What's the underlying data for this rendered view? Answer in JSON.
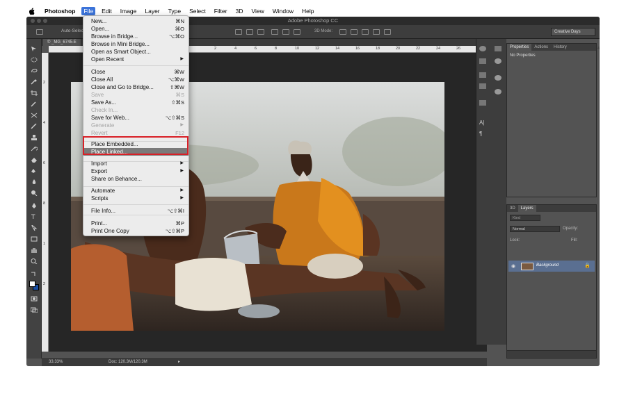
{
  "macbar": {
    "app": "Photoshop",
    "menus": [
      "File",
      "Edit",
      "Image",
      "Layer",
      "Type",
      "Select",
      "Filter",
      "3D",
      "View",
      "Window",
      "Help"
    ]
  },
  "window": {
    "title": "Adobe Photoshop CC"
  },
  "options_bar": {
    "auto_select": "Auto-Select",
    "mode_3d": "3D Mode:",
    "workspace": "Creative Days"
  },
  "document": {
    "tab": "© _MG_6745-E",
    "ruler_ticks": [
      "2",
      "4",
      "6",
      "8",
      "10",
      "12",
      "14",
      "16",
      "18",
      "20",
      "22",
      "24",
      "26",
      "28",
      "30",
      "32",
      "34",
      "36",
      "38",
      "40"
    ],
    "left_ticks": [
      "2",
      "4",
      "6",
      "8",
      "1",
      "2"
    ]
  },
  "status": {
    "zoom": "33.33%",
    "doc": "Doc: 120.3M/120.3M"
  },
  "properties_panel": {
    "tabs": [
      "Properties",
      "Actions",
      "History"
    ],
    "empty_text": "No Properties"
  },
  "layers_panel": {
    "tabs": [
      "3D",
      "Layers"
    ],
    "kind": "Kind",
    "blend_mode": "Normal",
    "opacity_label": "Opacity:",
    "lock_label": "Lock:",
    "fill_label": "Fill:",
    "layer_name": "Background"
  },
  "file_menu": {
    "items": [
      {
        "label": "New...",
        "shortcut": "⌘N"
      },
      {
        "label": "Open...",
        "shortcut": "⌘O"
      },
      {
        "label": "Browse in Bridge...",
        "shortcut": "⌥⌘O"
      },
      {
        "label": "Browse in Mini Bridge...",
        "shortcut": ""
      },
      {
        "label": "Open as Smart Object...",
        "shortcut": ""
      },
      {
        "label": "Open Recent",
        "shortcut": ""
      },
      {
        "label": "Close",
        "shortcut": "⌘W"
      },
      {
        "label": "Close All",
        "shortcut": "⌥⌘W"
      },
      {
        "label": "Close and Go to Bridge...",
        "shortcut": "⇧⌘W"
      },
      {
        "label": "Save",
        "shortcut": "⌘S"
      },
      {
        "label": "Save As...",
        "shortcut": "⇧⌘S"
      },
      {
        "label": "Check In...",
        "shortcut": ""
      },
      {
        "label": "Save for Web...",
        "shortcut": "⌥⇧⌘S"
      },
      {
        "label": "Generate",
        "shortcut": ""
      },
      {
        "label": "Revert",
        "shortcut": "F12"
      },
      {
        "label": "Place Embedded...",
        "shortcut": ""
      },
      {
        "label": "Place Linked...",
        "shortcut": ""
      },
      {
        "label": "Import",
        "shortcut": ""
      },
      {
        "label": "Export",
        "shortcut": ""
      },
      {
        "label": "Share on Behance...",
        "shortcut": ""
      },
      {
        "label": "Automate",
        "shortcut": ""
      },
      {
        "label": "Scripts",
        "shortcut": ""
      },
      {
        "label": "File Info...",
        "shortcut": "⌥⇧⌘I"
      },
      {
        "label": "Print...",
        "shortcut": "⌘P"
      },
      {
        "label": "Print One Copy",
        "shortcut": "⌥⇧⌘P"
      }
    ],
    "submenu_arrow": "▶"
  },
  "colors": {
    "highlight": "#7a7a7a",
    "callout": "#d81f26",
    "app_bg": "#535353"
  }
}
